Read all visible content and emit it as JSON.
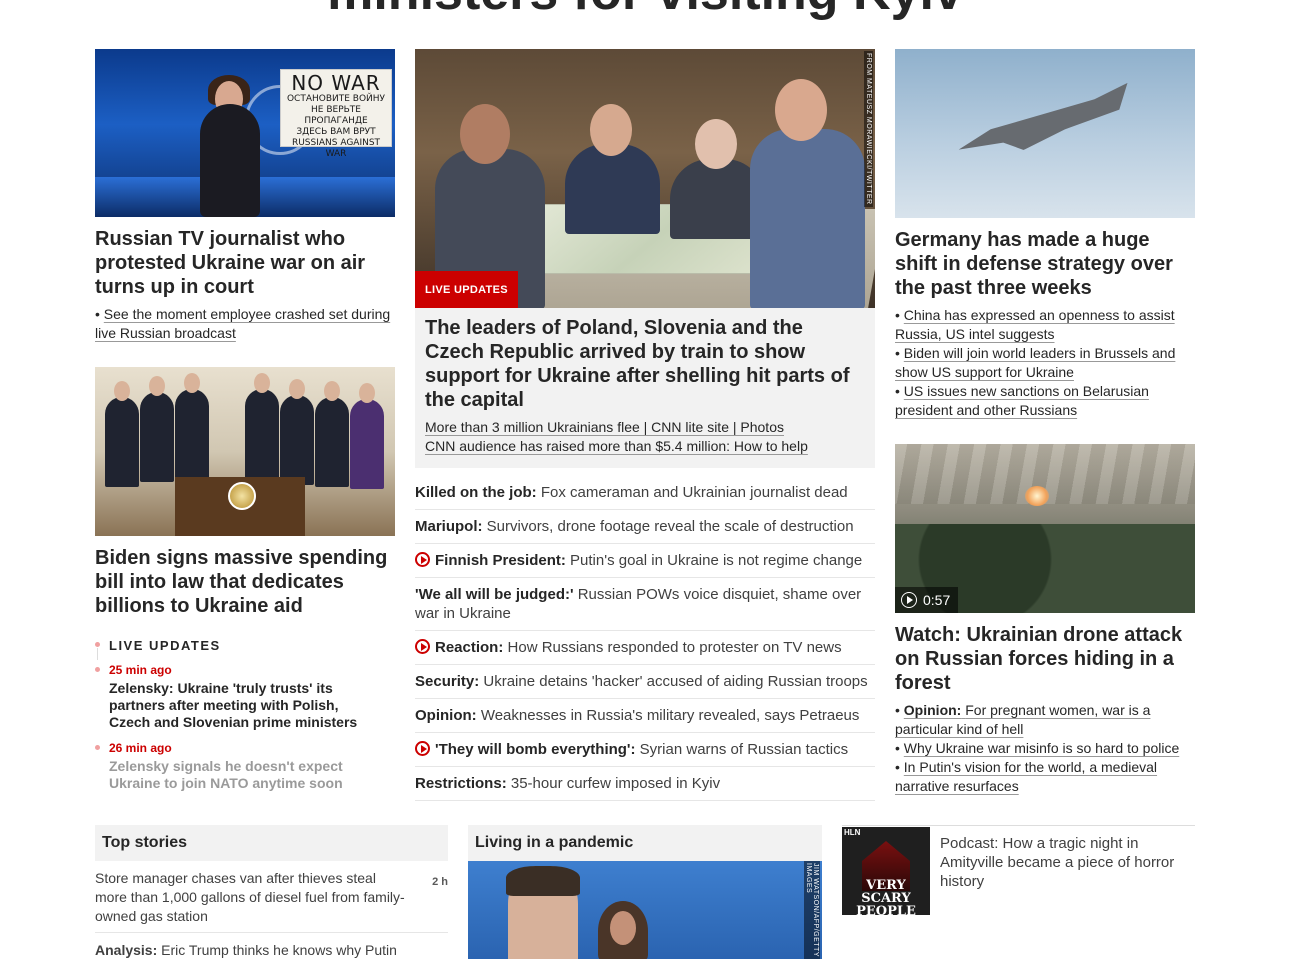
{
  "top_headline": "ministers for visiting Kyiv",
  "left": {
    "story1": {
      "headline": "Russian TV journalist who protested Ukraine war on air turns up in court",
      "bullet": "See the moment employee crashed set during live Russian broadcast",
      "sign_lines": [
        "NO WAR",
        "ОСТАНОВИТЕ ВОЙНУ",
        "НЕ ВЕРЬТЕ ПРОПАГАНДЕ",
        "ЗДЕСЬ ВАМ ВРУТ",
        "RUSSIANS AGAINST WAR"
      ]
    },
    "story2": {
      "headline": "Biden signs massive spending bill into law that dedicates billions to Ukraine aid"
    },
    "live": {
      "label": "LIVE UPDATES",
      "items": [
        {
          "time": "25 min ago",
          "text": "Zelensky: Ukraine 'truly trusts' its partners after meeting with Polish, Czech and Slovenian prime ministers"
        },
        {
          "time": "26 min ago",
          "text": "Zelensky signals he doesn't expect Ukraine to join NATO anytime soon"
        }
      ]
    }
  },
  "middle": {
    "photo_credit": "FROM MATEUSZ MORAWIECKI/TWITTER",
    "badge": "LIVE UPDATES",
    "headline": "The leaders of Poland, Slovenia and the Czech Republic arrived by train to show support for Ukraine after shelling hit parts of the capital",
    "links_line1": "More than 3 million Ukrainians flee | CNN lite site | Photos",
    "links_line2": "CNN audience has raised more than $5.4 million: How to help",
    "list": [
      {
        "label": "Killed on the job:",
        "text": "Fox cameraman and Ukrainian journalist dead",
        "video": false
      },
      {
        "label": "Mariupol:",
        "text": "Survivors, drone footage reveal the scale of destruction",
        "video": false
      },
      {
        "label": "Finnish President:",
        "text": "Putin's goal in Ukraine is not regime change",
        "video": true
      },
      {
        "label": "'We all will be judged:'",
        "text": "Russian POWs voice disquiet, shame over war in Ukraine",
        "video": false
      },
      {
        "label": "Reaction:",
        "text": "How Russians responded to protester on TV news",
        "video": true
      },
      {
        "label": "Security:",
        "text": "Ukraine detains 'hacker' accused of aiding Russian troops",
        "video": false
      },
      {
        "label": "Opinion:",
        "text": "Weaknesses in Russia's military revealed, says Petraeus",
        "video": false
      },
      {
        "label": "'They will bomb everything':",
        "text": "Syrian warns of Russian tactics",
        "video": true
      },
      {
        "label": "Restrictions:",
        "text": "35-hour curfew imposed in Kyiv",
        "video": false
      }
    ]
  },
  "right": {
    "story1": {
      "headline": "Germany has made a huge shift in defense strategy over the past three weeks",
      "bullets": [
        "China has expressed an openness to assist Russia, US intel suggests",
        "Biden will join world leaders in Brussels and show US support for Ukraine",
        "US issues new sanctions on Belarusian president and other Russians"
      ]
    },
    "story2": {
      "duration": "0:57",
      "headline": "Watch: Ukrainian drone attack on Russian forces hiding in a forest",
      "bullet1_label": "Opinion:",
      "bullet1_text": "For pregnant women, war is a particular kind of hell",
      "bullet2": "Why Ukraine war misinfo is so hard to police",
      "bullet3": "In Putin's vision for the world, a medieval narrative resurfaces"
    }
  },
  "bottom": {
    "top_stories": {
      "title": "Top stories",
      "items": [
        {
          "text": "Store manager chases van after thieves steal more than 1,000 gallons of diesel fuel from family-owned gas station",
          "age": "2 h"
        },
        {
          "label": "Analysis:",
          "text": "Eric Trump thinks he knows why Putin"
        }
      ]
    },
    "pandemic": {
      "title": "Living in a pandemic",
      "credit": "JIM WATSON/AFP/GETTY IMAGES"
    },
    "podcast": {
      "logo": "HLN",
      "thumb_title": "VERY SCARY PEOPLE",
      "text": "Podcast: How a tragic night in Amityville became a piece of horror history"
    }
  },
  "colors": {
    "accent": "#cc0000",
    "text": "#262626",
    "zone_bg": "#f2f2f2"
  }
}
